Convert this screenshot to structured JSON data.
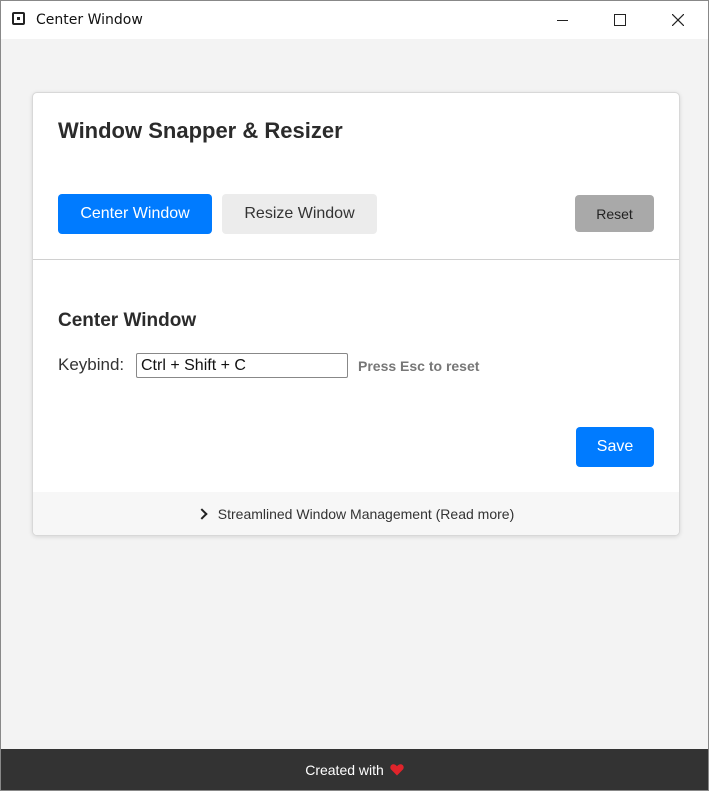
{
  "window": {
    "title": "Center Window"
  },
  "card": {
    "title": "Window Snapper & Resizer",
    "tabs": [
      {
        "label": "Center Window",
        "active": true
      },
      {
        "label": "Resize Window",
        "active": false
      }
    ],
    "reset_label": "Reset"
  },
  "section": {
    "title": "Center Window",
    "keybind_label": "Keybind:",
    "keybind_value": "Ctrl + Shift + C",
    "hint": "Press Esc to reset",
    "save_label": "Save"
  },
  "readmore": {
    "icon": "chevron-right-icon",
    "label": "Streamlined Window Management (Read more)"
  },
  "footer": {
    "text": "Created with",
    "icon": "heart-icon"
  },
  "colors": {
    "accent": "#007bff",
    "reset_button": "#a9a9a9",
    "footer_background": "#333333",
    "heart": "#e0242b"
  }
}
